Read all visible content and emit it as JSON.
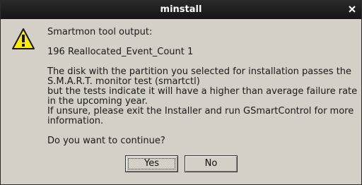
{
  "window": {
    "title": "minstall",
    "close_glyph": "✕"
  },
  "dialog": {
    "icon": "warning-icon",
    "lines": [
      "Smartmon tool output:",
      "",
      "196 Reallocated_Event_Count 1",
      "",
      "The disk with the partition you selected for installation passes the",
      "S.M.A.R.T. monitor test (smartctl)",
      "but the tests indicate it will have a higher than average failure rate",
      "in the upcoming year.",
      "If unsure, please exit the Installer and run GSmartControl for more",
      "information.",
      "",
      "Do you want to continue?"
    ]
  },
  "buttons": {
    "yes_label": "Yes",
    "no_label": "No"
  },
  "colors": {
    "titlebar": "#1f1f1f",
    "dialog_bg": "#d4d0c8",
    "warning_fill": "#ffee00"
  }
}
